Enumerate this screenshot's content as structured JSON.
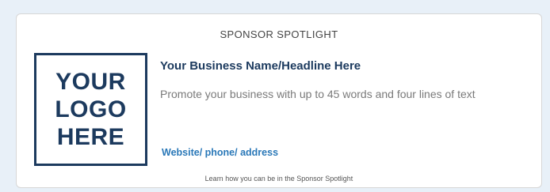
{
  "spotlight": {
    "section_title": "SPONSOR SPOTLIGHT",
    "logo_lines": [
      "YOUR",
      "LOGO",
      "HERE"
    ],
    "headline": "Your Business Name/Headline Here",
    "promo_text": "Promote your business with up to 45 words and four lines of text",
    "contact_link": "Website/ phone/ address",
    "learn_more_link": "Learn how you can be in the Sponsor Spotlight"
  },
  "colors": {
    "page_background": "#e8f0f8",
    "brand_navy": "#1c3a5e",
    "link_blue": "#2a78b8",
    "body_gray": "#7a7a7a"
  }
}
